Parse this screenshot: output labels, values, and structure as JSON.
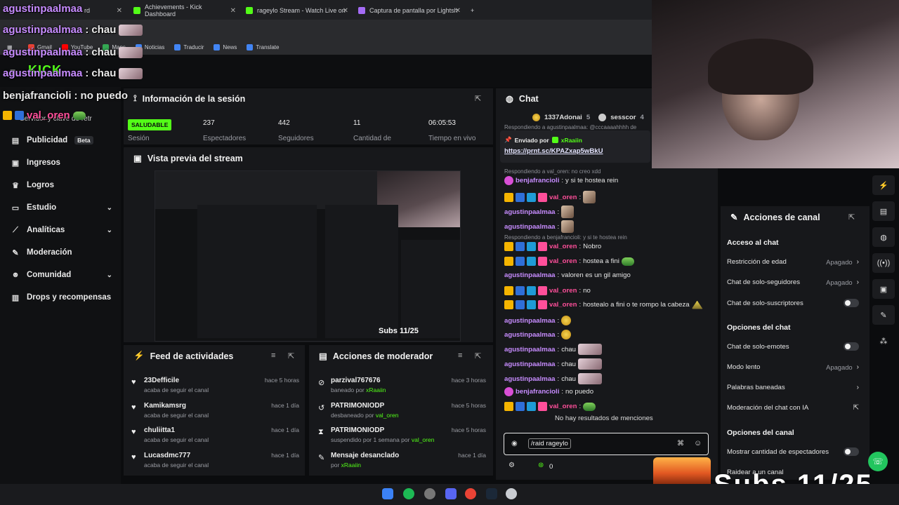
{
  "browser": {
    "tabs": [
      {
        "title": "agustinpaalmaa",
        "extra": "rd"
      },
      {
        "title": "Achievements - Kick Dashboard"
      },
      {
        "title": "rageylo Stream - Watch Live on"
      },
      {
        "title": "Captura de pantalla por Lightsh"
      }
    ],
    "new_tab": "+",
    "bookmarks": [
      "Gmail",
      "YouTube",
      "Maps",
      "Noticias",
      "Traducir",
      "News",
      "Translate"
    ]
  },
  "overlay_chat": [
    {
      "user": "agustinpaalmaa",
      "text": "",
      "top": true
    },
    {
      "user": "agustinpaalmaa",
      "text": "chau"
    },
    {
      "user": "agustinpaalmaa",
      "text": "chau"
    },
    {
      "user": "agustinpaalmaa",
      "text": "chau"
    },
    {
      "user": "benjafrancioli",
      "text": "no puedo"
    },
    {
      "user": "val_oren",
      "text": ""
    }
  ],
  "overlay_misc": {
    "server_label": "Servidor y clave de retr",
    "subs": "Subs 11/25"
  },
  "sidebar": {
    "items": [
      {
        "label": "Publicidad",
        "badge": "Beta",
        "icon": "megaphone-icon"
      },
      {
        "label": "Ingresos",
        "icon": "money-icon"
      },
      {
        "label": "Logros",
        "icon": "trophy-icon"
      },
      {
        "label": "Estudio",
        "icon": "studio-icon",
        "chevron": true
      },
      {
        "label": "Analíticas",
        "icon": "chart-icon",
        "chevron": true
      },
      {
        "label": "Moderación",
        "icon": "wrench-icon"
      },
      {
        "label": "Comunidad",
        "icon": "people-icon",
        "chevron": true
      },
      {
        "label": "Drops y recompensas",
        "icon": "gift-icon"
      }
    ]
  },
  "session": {
    "title": "Información de la sesión",
    "status": "SALUDABLE",
    "status_label": "Sesión",
    "stats": [
      {
        "value": "237",
        "label": "Espectadores"
      },
      {
        "value": "442",
        "label": "Seguidores"
      },
      {
        "value": "11",
        "label": "Cantidad de"
      },
      {
        "value": "06:05:53",
        "label": "Tiempo en vivo"
      }
    ]
  },
  "preview": {
    "title": "Vista previa del stream"
  },
  "feed": {
    "title": "Feed de actividades",
    "items": [
      {
        "name": "23Defficile",
        "sub": "acaba de seguir el canal",
        "time": "hace 5 horas"
      },
      {
        "name": "Kamikamsrg",
        "sub": "acaba de seguir el canal",
        "time": "hace 1 día"
      },
      {
        "name": "chuliitta1",
        "sub": "acaba de seguir el canal",
        "time": "hace 1 día"
      },
      {
        "name": "Lucasdmc777",
        "sub": "acaba de seguir el canal",
        "time": "hace 1 día"
      }
    ]
  },
  "modactions": {
    "title": "Acciones de moderador",
    "items": [
      {
        "name": "parzival767676",
        "sub_prefix": "baneado por",
        "by": "xRaaiin",
        "time": "hace 3 horas",
        "icon": "ban-icon"
      },
      {
        "name": "PATRIMONIODP",
        "sub_prefix": "desbaneado por",
        "by": "val_oren",
        "time": "hace 5 horas",
        "icon": "undo-icon"
      },
      {
        "name": "PATRIMONIODP",
        "sub_prefix": "suspendido por 1 semana por",
        "by": "val_oren",
        "time": "hace 5 horas",
        "icon": "hourglass-icon"
      },
      {
        "name": "Mensaje desanclado",
        "sub_prefix": "por",
        "by": "xRaaiin",
        "time": "hace 1 día",
        "icon": "pin-icon"
      }
    ]
  },
  "chat": {
    "title": "Chat",
    "top_users": [
      {
        "name": "1337Adonai",
        "count": "5"
      },
      {
        "name": "sesscor",
        "count": "4"
      }
    ],
    "pinned_label": "Enviado por",
    "pinned_by": "xRaaiin",
    "pinned_link": "https://prnt.sc/KPAZxap5wBkU",
    "reply_top": "Respondiendo a agustinpaalmaa: @cccaaaahhhh de",
    "messages": [
      {
        "reply": "Respondiendo a val_oren: no creo xdd"
      },
      {
        "user": "benjafrancioli",
        "text": "y si te hostea rein",
        "color": "#c78cff"
      },
      {
        "user": "val_oren",
        "text": "",
        "color": "#ff4f9a",
        "emote": "sq"
      },
      {
        "user": "agustinpaalmaa",
        "text": "",
        "color": "#c78cff",
        "emote": "sq"
      },
      {
        "user": "agustinpaalmaa",
        "text": "",
        "color": "#c78cff",
        "emote": "sq"
      },
      {
        "reply": "Respondiendo a benjafrancioli: y si te hostea rein"
      },
      {
        "user": "val_oren",
        "text": "Nobro",
        "color": "#ff4f9a"
      },
      {
        "user": "val_oren",
        "text": "hostea a fini",
        "color": "#ff4f9a",
        "emote": "frog"
      },
      {
        "user": "agustinpaalmaa",
        "text": "valoren es un gil amigo",
        "color": "#c78cff"
      },
      {
        "user": "val_oren",
        "text": "no",
        "color": "#ff4f9a"
      },
      {
        "user": "val_oren",
        "text": "hostealo a fini o te rompo la cabeza",
        "color": "#ff4f9a",
        "emote": "hat"
      },
      {
        "user": "agustinpaalmaa",
        "text": "",
        "color": "#c78cff",
        "emote": "yel"
      },
      {
        "user": "agustinpaalmaa",
        "text": "",
        "color": "#c78cff",
        "emote": "yel"
      },
      {
        "user": "agustinpaalmaa",
        "text": "chau",
        "color": "#c78cff",
        "emote": "big"
      },
      {
        "user": "agustinpaalmaa",
        "text": "chau",
        "color": "#c78cff",
        "emote": "big"
      },
      {
        "user": "agustinpaalmaa",
        "text": "chau",
        "color": "#c78cff",
        "emote": "big"
      },
      {
        "user": "benjafrancioli",
        "text": "no puedo",
        "color": "#c78cff"
      },
      {
        "user": "val_oren",
        "text": "",
        "color": "#ff4f9a",
        "emote": "frog"
      }
    ],
    "no_mentions": "No hay resultados de menciones",
    "input_value": "/raid rageylo",
    "points": "0"
  },
  "channel_actions": {
    "title": "Acciones de canal",
    "sections": [
      {
        "heading": "Acceso al chat",
        "rows": [
          {
            "label": "Restricción de edad",
            "value": "Apagado",
            "type": "arrow"
          },
          {
            "label": "Chat de solo-seguidores",
            "value": "Apagado",
            "type": "arrow"
          },
          {
            "label": "Chat de solo-suscriptores",
            "type": "toggle"
          }
        ]
      },
      {
        "heading": "Opciones del chat",
        "rows": [
          {
            "label": "Chat de solo-emotes",
            "type": "toggle"
          },
          {
            "label": "Modo lento",
            "value": "Apagado",
            "type": "arrow"
          },
          {
            "label": "Palabras baneadas",
            "type": "arrow"
          },
          {
            "label": "Moderación del chat con IA",
            "type": "external"
          }
        ]
      },
      {
        "heading": "Opciones del canal",
        "rows": [
          {
            "label": "Mostrar cantidad de espectadores",
            "type": "toggle"
          },
          {
            "label": "Raidear a un canal",
            "type": "none"
          }
        ]
      }
    ]
  },
  "colors": {
    "accent": "#53fc18",
    "purple": "#c78cff",
    "pink": "#ff4f9a",
    "panel": "#17181b"
  }
}
